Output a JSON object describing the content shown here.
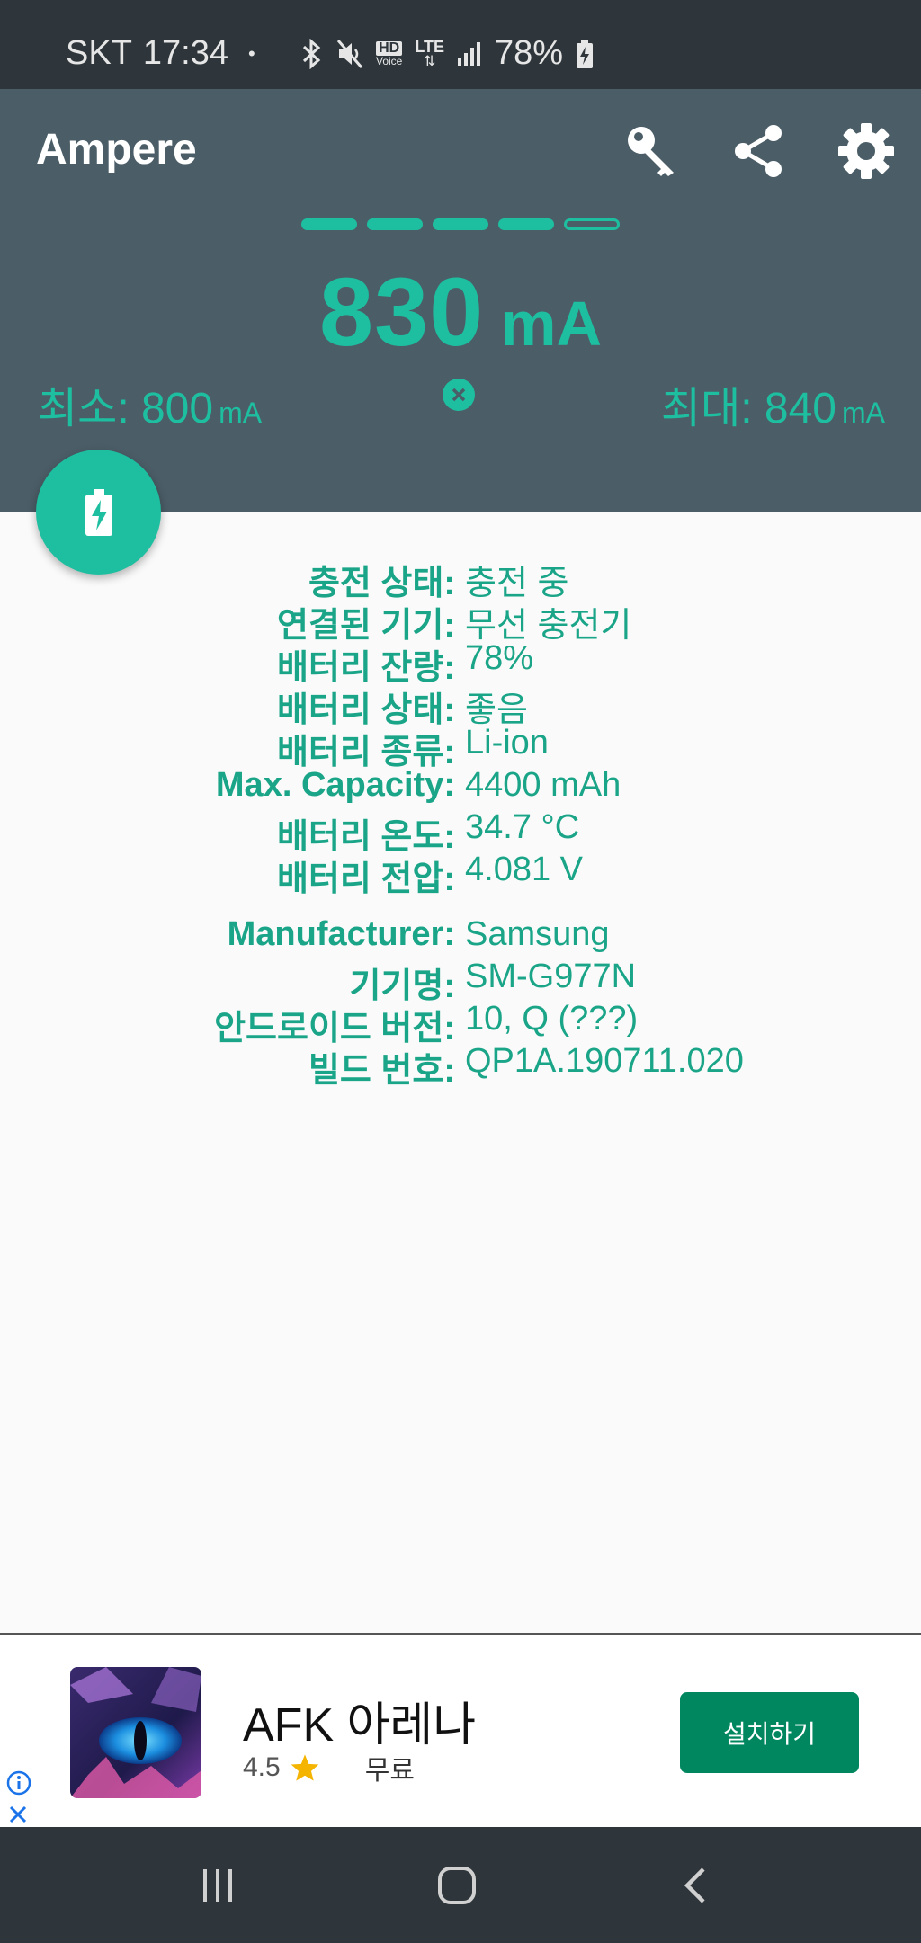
{
  "status_bar": {
    "carrier": "SKT",
    "time": "17:34",
    "dot": "•",
    "hd_label": "HD",
    "voice_label": "Voice",
    "lte_label": "LTE",
    "battery_percent": "78%"
  },
  "app": {
    "title": "Ampere",
    "level_bars": {
      "filled": 4,
      "total": 5
    },
    "current_value": "830",
    "current_unit": "mA",
    "min_label": "최소: 800",
    "min_unit": "mA",
    "max_label": "최대: 840",
    "max_unit": "mA"
  },
  "info": {
    "battery": [
      {
        "label": "충전 상태:",
        "value": "충전 중"
      },
      {
        "label": "연결된 기기:",
        "value": "무선 충전기"
      },
      {
        "label": "배터리 잔량:",
        "value": "78%"
      },
      {
        "label": "배터리 상태:",
        "value": "좋음"
      },
      {
        "label": "배터리 종류:",
        "value": "Li-ion"
      },
      {
        "label": "Max. Capacity:",
        "value": "4400 mAh"
      },
      {
        "label": "배터리 온도:",
        "value": "34.7 °C"
      },
      {
        "label": "배터리 전압:",
        "value": "4.081 V"
      }
    ],
    "device": [
      {
        "label": "Manufacturer:",
        "value": "Samsung"
      },
      {
        "label": "기기명:",
        "value": "SM-G977N"
      },
      {
        "label": "안드로이드 버전:",
        "value": "10, Q (???)"
      },
      {
        "label": "빌드 번호:",
        "value": "QP1A.190711.020"
      }
    ]
  },
  "ad": {
    "title": "AFK 아레나",
    "rating": "4.5",
    "price": "무료",
    "install_label": "설치하기"
  },
  "colors": {
    "accent": "#1dbfa0",
    "text_accent": "#1ba588",
    "header_bg": "#4b5d67",
    "status_bg": "#2e363b",
    "install_green": "#01875f"
  }
}
